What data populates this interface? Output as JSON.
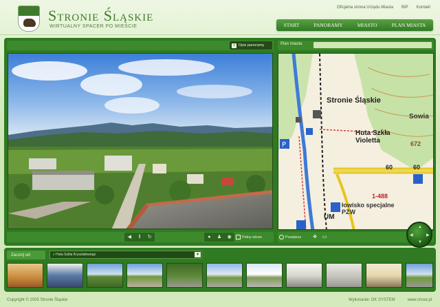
{
  "header": {
    "title": "Stronie Śląskie",
    "subtitle": "WIRTUALNY SPACER PO MIEŚCIE",
    "top_links": [
      "Oficjalna strona Urzędu Miasta",
      "BIP",
      "Kontakt"
    ],
    "nav": [
      "START",
      "PANORAMY",
      "MIASTO",
      "PLAN MIASTA"
    ]
  },
  "panorama": {
    "info_button": "Opis panoramy",
    "full_screen_label": "Pełny ekran"
  },
  "map": {
    "title": "Plan miasta",
    "labels": {
      "town": "Stronie Śląskie",
      "glass": "Huta Szkła Violetta",
      "fish": "łowisko specjalne PZW",
      "um": "UM",
      "peak": "Sowia",
      "elev1": "672",
      "elev2": "60",
      "elev3": "60",
      "road": "1-488"
    },
    "enlarge_label": "Powiększ"
  },
  "thumbnails": {
    "start_label": "Zacznij od:",
    "selected": "» Huta Szkła Kryształowego"
  },
  "footer": {
    "copyright": "Copyright © 2005 Stronie Śląskie",
    "credits": "Wykonanie: DK SYSTEM",
    "url": "www.chour.pl"
  },
  "colors": {
    "brand_green": "#2f7a22",
    "light_bg": "#d9edc4",
    "title_green": "#3f7a2d"
  }
}
